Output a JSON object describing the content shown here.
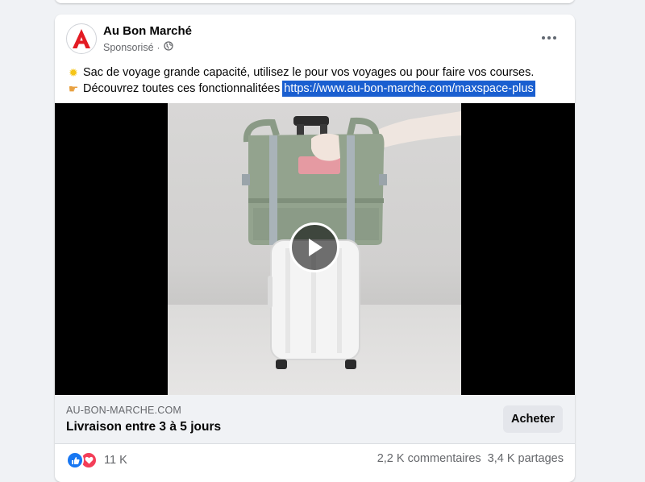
{
  "post": {
    "page_name": "Au Bon Marché",
    "sponsored_label": "Sponsorisé",
    "separator": "·",
    "avatar_letter": "A",
    "text_line1": "Sac de voyage grande capacité, utilisez le pour vos voyages ou pour faire vos courses.",
    "text_line2": "Découvrez toutes ces fonctionnalitées",
    "link": "https://www.au-bon-marche.com/maxspace-plus",
    "icons": {
      "line1_emoji": "sun-emoji-icon",
      "line2_emoji": "pointing-hand-emoji-icon",
      "audience": "globe-icon",
      "more": "more-options-icon",
      "play": "play-icon"
    }
  },
  "link_preview": {
    "domain": "AU-BON-MARCHE.COM",
    "headline": "Livraison entre 3 à 5 jours",
    "cta_label": "Acheter"
  },
  "stats": {
    "reaction_count": "11 K",
    "comments": "2,2 K commentaires",
    "shares": "3,4 K partages"
  },
  "colors": {
    "brand_red": "#e31b23",
    "link_highlight": "#1a5fd0",
    "like_blue": "#1877f2",
    "love_red": "#f33e58"
  }
}
